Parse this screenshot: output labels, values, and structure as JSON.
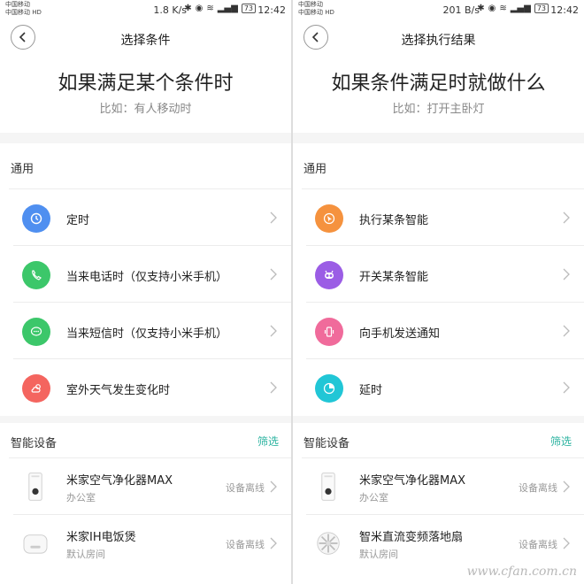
{
  "left": {
    "status": {
      "carrier1": "中国移动",
      "carrier2": "中国移动",
      "hd": "HD",
      "speed": "1.8 K/s",
      "battery": "73",
      "time": "12:42"
    },
    "nav_title": "选择条件",
    "big_title": "如果满足某个条件时",
    "hint": "比如：有人移动时",
    "general_label": "通用",
    "items": [
      {
        "label": "定时",
        "color": "#4f8ff0",
        "icon": "clock-icon"
      },
      {
        "label": "当来电话时（仅支持小米手机）",
        "color": "#3cc76a",
        "icon": "phone-icon"
      },
      {
        "label": "当来短信时（仅支持小米手机）",
        "color": "#3cc76a",
        "icon": "message-icon"
      },
      {
        "label": "室外天气发生变化时",
        "color": "#f4655f",
        "icon": "weather-icon"
      }
    ],
    "devices_label": "智能设备",
    "filter_label": "筛选",
    "devices": [
      {
        "name": "米家空气净化器MAX",
        "room": "办公室",
        "status": "设备离线",
        "icon": "air-purifier-icon"
      },
      {
        "name": "米家IH电饭煲",
        "room": "默认房间",
        "status": "设备离线",
        "icon": "rice-cooker-icon"
      }
    ]
  },
  "right": {
    "status": {
      "carrier1": "中国移动",
      "carrier2": "中国移动",
      "hd": "HD",
      "speed": "201 B/s",
      "battery": "73",
      "time": "12:42"
    },
    "nav_title": "选择执行结果",
    "big_title": "如果条件满足时就做什么",
    "hint": "比如：打开主卧灯",
    "general_label": "通用",
    "items": [
      {
        "label": "执行某条智能",
        "color": "#f5923e",
        "icon": "cursor-icon"
      },
      {
        "label": "开关某条智能",
        "color": "#9b5de5",
        "icon": "toggle-icon"
      },
      {
        "label": "向手机发送通知",
        "color": "#f06b9b",
        "icon": "notification-icon"
      },
      {
        "label": "延时",
        "color": "#21c6d6",
        "icon": "timer-icon"
      }
    ],
    "devices_label": "智能设备",
    "filter_label": "筛选",
    "devices": [
      {
        "name": "米家空气净化器MAX",
        "room": "办公室",
        "status": "设备离线",
        "icon": "air-purifier-icon"
      },
      {
        "name": "智米直流变频落地扇",
        "room": "默认房间",
        "status": "设备离线",
        "icon": "fan-icon"
      }
    ]
  },
  "watermark": "www.cfan.com.cn"
}
